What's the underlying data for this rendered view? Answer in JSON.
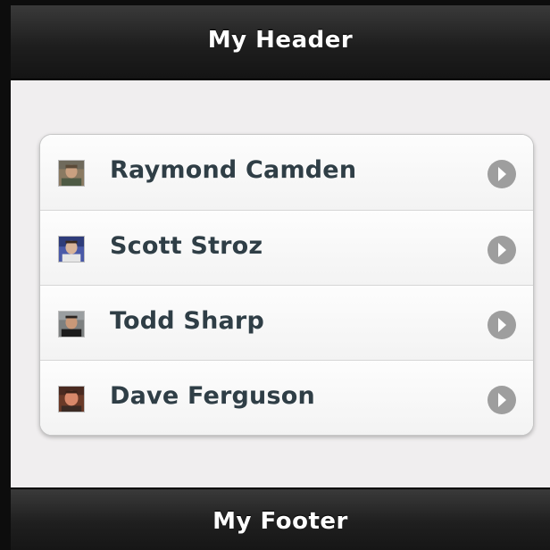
{
  "header": {
    "title": "My Header"
  },
  "list": {
    "items": [
      {
        "label": "Raymond Camden",
        "avatar_icon": "person-photo-icon",
        "action_icon": "chevron-right-icon"
      },
      {
        "label": "Scott Stroz",
        "avatar_icon": "person-photo-icon",
        "action_icon": "chevron-right-icon"
      },
      {
        "label": "Todd Sharp",
        "avatar_icon": "person-photo-icon",
        "action_icon": "chevron-right-icon"
      },
      {
        "label": "Dave Ferguson",
        "avatar_icon": "person-photo-icon",
        "action_icon": "chevron-right-icon"
      }
    ]
  },
  "footer": {
    "title": "My Footer"
  },
  "colors": {
    "bar_background": "#1e1e1e",
    "content_background": "#f0eeef",
    "item_text": "#2f3e46",
    "chevron": "#9e9e9e"
  }
}
